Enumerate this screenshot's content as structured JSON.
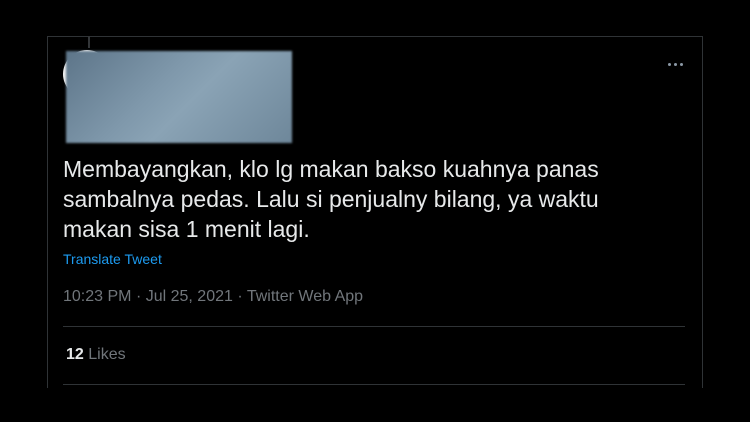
{
  "tweet": {
    "text_lines": [
      "Membayangkan, klo lg makan bakso kuahnya panas",
      "sambalnya pedas. Lalu si penjualny bilang, ya waktu",
      "makan sisa 1 menit lagi."
    ],
    "translate_label": "Translate Tweet",
    "time": "10:23 PM",
    "separator": "·",
    "date": "Jul 25, 2021",
    "source": "Twitter Web App",
    "likes_count": "12",
    "likes_label": "Likes"
  },
  "icons": {
    "more": "more-horizontal-icon"
  },
  "colors": {
    "background": "#000000",
    "text": "#e7e9ea",
    "secondary": "#71767b",
    "link": "#1d9bf0",
    "border": "#2f3336"
  }
}
